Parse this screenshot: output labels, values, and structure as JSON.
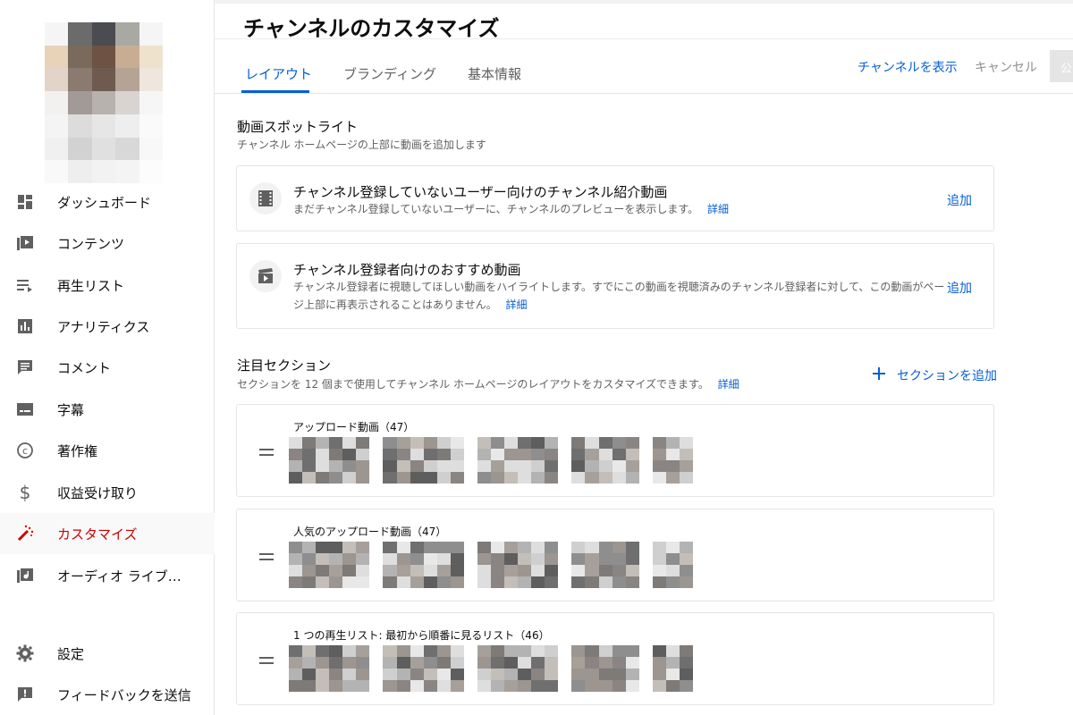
{
  "page": {
    "title": "チャンネルのカスタマイズ",
    "tabs": [
      "レイアウト",
      "ブランディング",
      "基本情報"
    ],
    "active_tab": "レイアウト",
    "view_channel": "チャンネルを表示",
    "cancel": "キャンセル",
    "publish": "公"
  },
  "sidebar": {
    "items": [
      {
        "label": "ダッシュボード",
        "icon": "dashboard-icon"
      },
      {
        "label": "コンテンツ",
        "icon": "content-icon"
      },
      {
        "label": "再生リスト",
        "icon": "playlist-icon"
      },
      {
        "label": "アナリティクス",
        "icon": "analytics-icon"
      },
      {
        "label": "コメント",
        "icon": "comment-icon"
      },
      {
        "label": "字幕",
        "icon": "subtitles-icon"
      },
      {
        "label": "著作権",
        "icon": "copyright-icon"
      },
      {
        "label": "収益受け取り",
        "icon": "dollar-icon"
      },
      {
        "label": "カスタマイズ",
        "icon": "magic-wand-icon",
        "active": true
      },
      {
        "label": "オーディオ ライブ…",
        "icon": "audio-library-icon"
      }
    ],
    "settings": "設定",
    "feedback": "フィードバックを送信"
  },
  "spotlight": {
    "title": "動画スポットライト",
    "subtitle": "チャンネル ホームページの上部に動画を追加します",
    "cards": [
      {
        "title": "チャンネル登録していないユーザー向けのチャンネル紹介動画",
        "desc": "まだチャンネル登録していないユーザーに、チャンネルのプレビューを表示します。",
        "link": "詳細",
        "action": "追加"
      },
      {
        "title": "チャンネル登録者向けのおすすめ動画",
        "desc": "チャンネル登録者に視聴してほしい動画をハイライトします。すでにこの動画を視聴済みのチャンネル登録者に対して、この動画がページ上部に再表示されることはありません。",
        "link": "詳細",
        "action": "追加"
      }
    ]
  },
  "featured": {
    "title": "注目セクション",
    "subtitle": "セクションを 12 個まで使用してチャンネル ホームページのレイアウトをカスタマイズできます。",
    "link": "詳細",
    "add_section": "セクションを追加",
    "sections": [
      {
        "title": "アップロード動画（47）"
      },
      {
        "title": "人気のアップロード動画（47）"
      },
      {
        "title": "1 つの再生リスト: 最初から順番に見るリスト（46）"
      }
    ]
  },
  "colors": {
    "accent": "#065fd4",
    "active_nav": "#cc0000"
  }
}
